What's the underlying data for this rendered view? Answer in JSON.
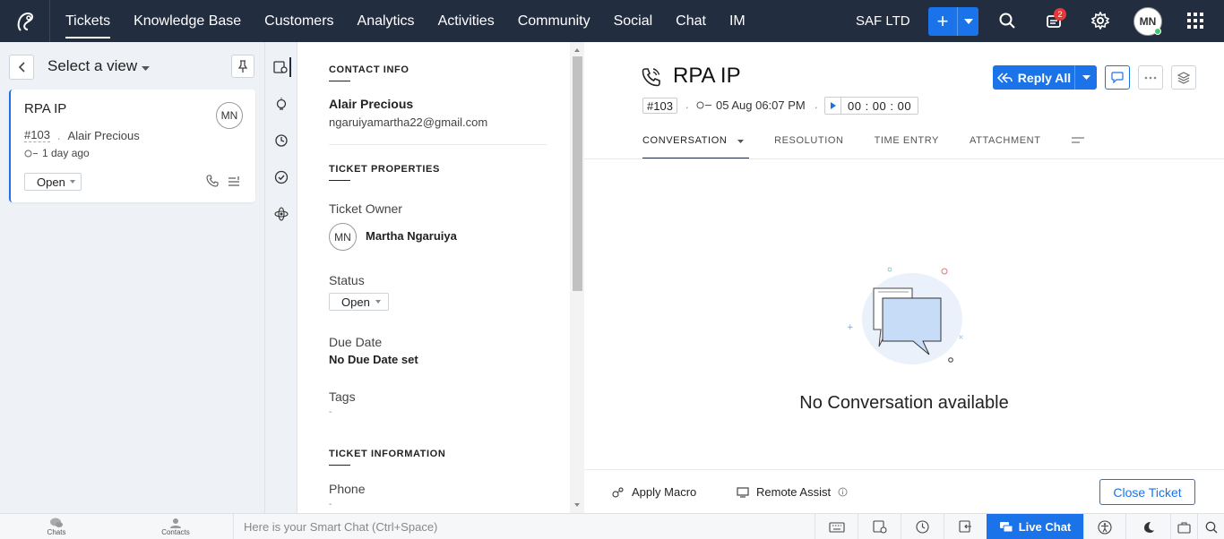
{
  "nav": {
    "items": [
      "Tickets",
      "Knowledge Base",
      "Customers",
      "Analytics",
      "Activities",
      "Community",
      "Social",
      "Chat",
      "IM"
    ],
    "org": "SAF LTD",
    "notif_count": "2",
    "avatar": "MN"
  },
  "left": {
    "view_label": "Select a view",
    "ticket": {
      "title": "RPA IP",
      "avatar": "MN",
      "number": "#103",
      "contact": "Alair Precious",
      "time": "1 day ago",
      "status": "Open"
    }
  },
  "details": {
    "contact_info_header": "CONTACT INFO",
    "contact_name": "Alair Precious",
    "contact_email": "ngaruiyamartha22@gmail.com",
    "ticket_props_header": "TICKET PROPERTIES",
    "owner_label": "Ticket Owner",
    "owner_avatar": "MN",
    "owner_name": "Martha Ngaruiya",
    "status_label": "Status",
    "status_value": "Open",
    "due_label": "Due Date",
    "due_value": "No Due Date set",
    "tags_label": "Tags",
    "tags_value": "-",
    "ticket_info_header": "TICKET INFORMATION",
    "phone_label": "Phone",
    "phone_value": "-"
  },
  "main": {
    "title": "RPA IP",
    "number": "#103",
    "datetime": "05 Aug 06:07 PM",
    "timer": "00 : 00 : 00",
    "reply_all": "Reply All",
    "tabs": [
      "CONVERSATION",
      "RESOLUTION",
      "TIME ENTRY",
      "ATTACHMENT"
    ],
    "empty_text": "No Conversation available",
    "apply_macro": "Apply Macro",
    "remote_assist": "Remote Assist",
    "close_ticket": "Close Ticket"
  },
  "bottom": {
    "chats": "Chats",
    "contacts": "Contacts",
    "smartchat_placeholder": "Here is your Smart Chat (Ctrl+Space)",
    "live_chat": "Live Chat"
  },
  "colors": {
    "nav_bg": "#222d3f",
    "accent": "#1a73e8",
    "badge": "#e53935",
    "online": "#3ec76b"
  }
}
